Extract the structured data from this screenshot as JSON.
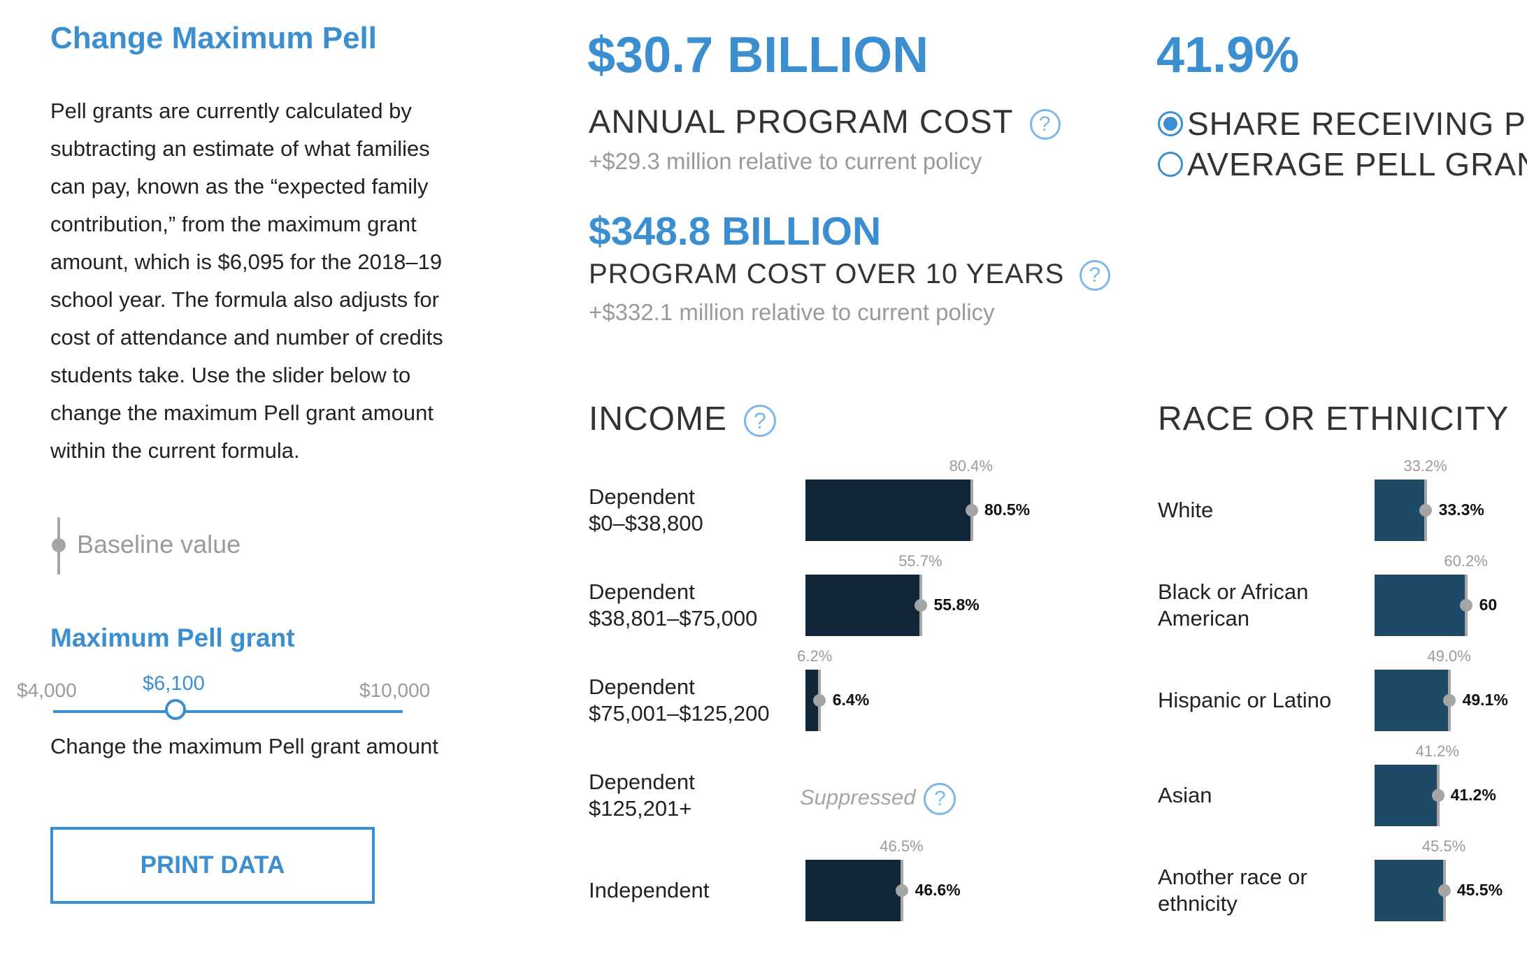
{
  "left": {
    "title": "Change Maximum Pell",
    "description": "Pell grants are currently calculated by subtracting an estimate of what families can pay, known as the “expected family contribution,” from the maximum grant amount, which is $6,095 for the 2018–19 school year. The formula also adjusts for cost of attendance and number of credits students take. Use the slider below to change the maximum Pell grant amount within the current formula.",
    "baseline_legend": "Baseline value",
    "slider": {
      "title": "Maximum Pell grant",
      "min_label": "$4,000",
      "max_label": "$10,000",
      "current_label": "$6,100",
      "min": 4000,
      "max": 10000,
      "value": 6100,
      "caption": "Change the maximum Pell grant amount"
    },
    "print_button": "PRINT DATA"
  },
  "metrics": {
    "annual_cost_value": "$30.7 BILLION",
    "annual_cost_label": "ANNUAL PROGRAM COST",
    "annual_cost_delta": "+$29.3 million relative to current policy",
    "ten_year_value": "$348.8 BILLION",
    "ten_year_label": "PROGRAM COST OVER 10 YEARS",
    "ten_year_delta": "+$332.1 million relative to current policy",
    "help_glyph": "?",
    "share_value": "41.9%",
    "radio_options": [
      "SHARE RECEIVING PELL",
      "AVERAGE PELL GRANT"
    ],
    "radio_selected": 0
  },
  "income": {
    "title": "INCOME",
    "bar_color": "#12263a",
    "suppressed_label": "Suppressed",
    "rows": [
      {
        "label": "Dependent\n$0–$38,800",
        "baseline": 80.4,
        "baseline_label": "80.4%",
        "value": 80.5,
        "value_label": "80.5%"
      },
      {
        "label": "Dependent\n$38,801–$75,000",
        "baseline": 55.7,
        "baseline_label": "55.7%",
        "value": 55.8,
        "value_label": "55.8%"
      },
      {
        "label": "Dependent\n$75,001–$125,200",
        "baseline": 6.2,
        "baseline_label": "6.2%",
        "value": 6.4,
        "value_label": "6.4%"
      },
      {
        "label": "Dependent\n$125,201+",
        "suppressed": true
      },
      {
        "label": "Independent",
        "baseline": 46.5,
        "baseline_label": "46.5%",
        "value": 46.6,
        "value_label": "46.6%"
      }
    ]
  },
  "race": {
    "title": "RACE OR ETHNICITY",
    "bar_color": "#1f4a67",
    "rows": [
      {
        "label": "White",
        "baseline": 33.2,
        "baseline_label": "33.2%",
        "value": 33.3,
        "value_label": "33.3%"
      },
      {
        "label": "Black or African\nAmerican",
        "baseline": 60.2,
        "baseline_label": "60.2%",
        "value": 60.3,
        "value_label": "60"
      },
      {
        "label": "Hispanic or Latino",
        "baseline": 49.0,
        "baseline_label": "49.0%",
        "value": 49.1,
        "value_label": "49.1%"
      },
      {
        "label": "Asian",
        "baseline": 41.2,
        "baseline_label": "41.2%",
        "value": 41.2,
        "value_label": "41.2%"
      },
      {
        "label": "Another race or\nethnicity",
        "baseline": 45.5,
        "baseline_label": "45.5%",
        "value": 45.5,
        "value_label": "45.5%"
      }
    ]
  }
}
